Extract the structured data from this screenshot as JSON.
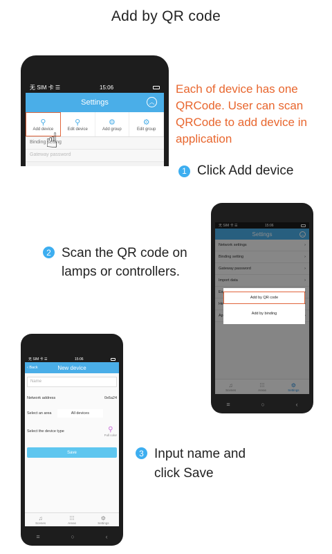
{
  "page_title": "Add by QR code",
  "description": "Each of device has one QRCode. User can scan QRCode to add device in application",
  "steps": [
    {
      "num": "1",
      "text": "Click Add device"
    },
    {
      "num": "2",
      "text": "Scan the QR code on lamps or controllers."
    },
    {
      "num": "3",
      "text": "Input name and click Save"
    }
  ],
  "phone1": {
    "status_carrier": "无 SIM 卡 ☰",
    "status_time": "15:06",
    "title": "Settings",
    "tools": [
      {
        "label": "Add device",
        "icon": "bulb-add-icon"
      },
      {
        "label": "Edit device",
        "icon": "bulb-edit-icon"
      },
      {
        "label": "Add group",
        "icon": "group-add-icon"
      },
      {
        "label": "Edit group",
        "icon": "group-edit-icon"
      }
    ],
    "rows": [
      "Binding setting",
      "Gateway password"
    ]
  },
  "phone2": {
    "status_carrier": "无 SIM 卡 ☰",
    "status_time": "15:06",
    "title": "Settings",
    "rows": [
      "Network settings",
      "Binding setting",
      "Gateway password",
      "Import data",
      "Export data",
      "Help",
      "App information"
    ],
    "popup": [
      "Add by QR code",
      "Add by binding"
    ],
    "tabs": [
      "Scenes",
      "Areas",
      "Settings"
    ]
  },
  "phone3": {
    "status_carrier": "无 SIM 卡 ☰",
    "status_time": "15:06",
    "back": "Back",
    "title": "New device",
    "name_placeholder": "Name",
    "network_label": "Network address",
    "network_value": "0x6a24",
    "area_label": "Select an area",
    "area_value": "All devices",
    "type_label": "Select the device type",
    "type_value": "Full color",
    "save": "Save",
    "tabs": [
      "Scenes",
      "Areas",
      "Settings"
    ]
  },
  "colors": {
    "accent": "#4aaee8",
    "highlight": "#e0643a",
    "orange_text": "#e8662e",
    "step_badge": "#3daef0"
  }
}
